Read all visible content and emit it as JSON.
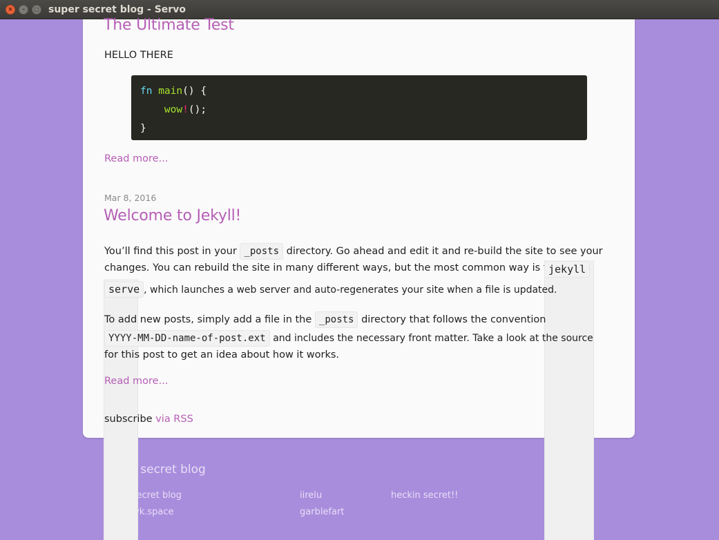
{
  "window": {
    "title": "super secret blog - Servo",
    "close_glyph": "×",
    "min_glyph": "–",
    "max_glyph": "□"
  },
  "post1": {
    "title": "The Ultimate Test",
    "body": "HELLO THERE",
    "code": {
      "line1_kw": "fn",
      "line1_fn": "main",
      "line1_rest": "() {",
      "line2_macro": "wow",
      "line2_bang": "!",
      "line2_rest": "();",
      "line3": "}"
    },
    "read_more": "Read more..."
  },
  "post2": {
    "date": "Mar 8, 2016",
    "title": "Welcome to Jekyll!",
    "p1_a": "You’ll find this post in your",
    "p1_code1": "_posts",
    "p1_b": "directory. Go ahead and edit it and re-build the site to see your",
    "p1_c": "changes. You can rebuild the site in many different ways, but the most common way is to run",
    "p1_code2a": "jekyll",
    "p1_code2b": "serve",
    "p1_d": ", which launches a web server and auto-regenerates your site when a file is updated.",
    "p2_a": "To add new posts, simply add a file in the",
    "p2_code1": "_posts",
    "p2_b": "directory that follows the convention",
    "p2_code2": "YYYY-MM-DD-name-of-post.ext",
    "p2_c": "and includes the necessary front matter. Take a look at the source",
    "p2_d": "for this post to get an idea about how it works.",
    "read_more": "Read more..."
  },
  "subscribe": {
    "label": "subscribe",
    "link": "via RSS"
  },
  "footer": {
    "title": "super secret blog",
    "col1": [
      "super secret blog",
      "hi@pawk.space"
    ],
    "col2": [
      "iirelu",
      "garblefart"
    ],
    "col3": [
      "heckin secret!!"
    ]
  },
  "colors": {
    "background": "#a98ddd",
    "accent": "#b55fb5",
    "code_bg": "#272822"
  }
}
